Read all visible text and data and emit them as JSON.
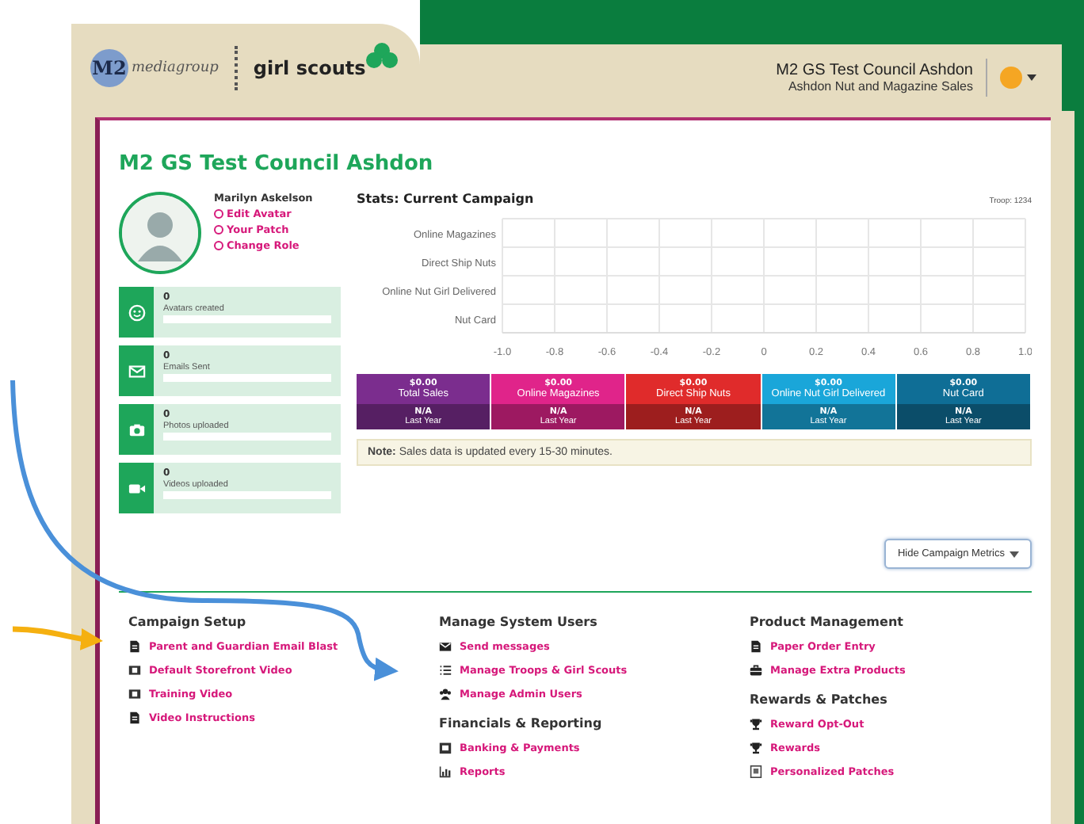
{
  "logo": {
    "brand": "M2",
    "brand_sub": "mediagroup",
    "partner": "girl scouts"
  },
  "header": {
    "council": "M2 GS Test Council Ashdon",
    "sale": "Ashdon Nut and Magazine Sales"
  },
  "page_title": "M2 GS Test Council Ashdon",
  "profile": {
    "name": "Marilyn Askelson",
    "links": [
      "Edit Avatar",
      "Your Patch",
      "Change Role"
    ]
  },
  "stat_cards": [
    {
      "count": "0",
      "label": "Avatars created",
      "level": 0
    },
    {
      "count": "0",
      "label": "Emails Sent",
      "level": 0
    },
    {
      "count": "0",
      "label": "Photos uploaded",
      "level": 0
    },
    {
      "count": "0",
      "label": "Videos uploaded",
      "level": 0
    }
  ],
  "stats": {
    "title": "Stats: Current Campaign",
    "troop": "Troop: 1234",
    "chart_data": {
      "type": "bar",
      "orientation": "horizontal",
      "categories": [
        "Online Magazines",
        "Direct Ship Nuts",
        "Online Nut Girl Delivered",
        "Nut Card"
      ],
      "values": [
        0,
        0,
        0,
        0
      ],
      "xlim": [
        -1,
        1
      ],
      "grid": true,
      "xticks": [
        {
          "value": -1,
          "label": "-1.0"
        },
        -0.8,
        -0.6,
        -0.4,
        -0.2,
        0,
        0.2,
        0.4,
        0.6,
        0.8,
        {
          "value": 1,
          "label": "1.0"
        }
      ]
    },
    "tiles": [
      {
        "amount": "$0.00",
        "label": "Total Sales",
        "prior": "N/A",
        "prior_label": "Last Year",
        "color": "#7b2d8e"
      },
      {
        "amount": "$0.00",
        "label": "Online Magazines",
        "prior": "N/A",
        "prior_label": "Last Year",
        "color": "#e0248a"
      },
      {
        "amount": "$0.00",
        "label": "Direct Ship Nuts",
        "prior": "N/A",
        "prior_label": "Last Year",
        "color": "#e02b2b"
      },
      {
        "amount": "$0.00",
        "label": "Online Nut Girl Delivered",
        "prior": "N/A",
        "prior_label": "Last Year",
        "color": "#1aa6d9"
      },
      {
        "amount": "$0.00",
        "label": "Nut Card",
        "prior": "N/A",
        "prior_label": "Last Year",
        "color": "#0f6e96"
      }
    ],
    "note": "**Note:** Sales data is updated every 15-30 minutes."
  },
  "metrics_button": "Hide Campaign Metrics",
  "link_columns": [
    {
      "sections": [
        {
          "title": "Campaign Setup",
          "links": [
            "Parent and Guardian Email Blast",
            "Default Storefront Video",
            "Training Video",
            "Video Instructions"
          ]
        }
      ]
    },
    {
      "sections": [
        {
          "title": "Manage System Users",
          "links": [
            "Send messages",
            "Manage Troops & Girl Scouts",
            "Manage Admin Users"
          ]
        },
        {
          "title": "Financials & Reporting",
          "links": [
            "Banking & Payments",
            "Reports"
          ]
        }
      ]
    },
    {
      "sections": [
        {
          "title": "Product Management",
          "links": [
            "Paper Order Entry",
            "Manage Extra Products"
          ]
        },
        {
          "title": "Rewards & Patches",
          "links": [
            "Reward Opt-Out",
            "Rewards",
            "Personalized Patches"
          ]
        }
      ]
    }
  ]
}
